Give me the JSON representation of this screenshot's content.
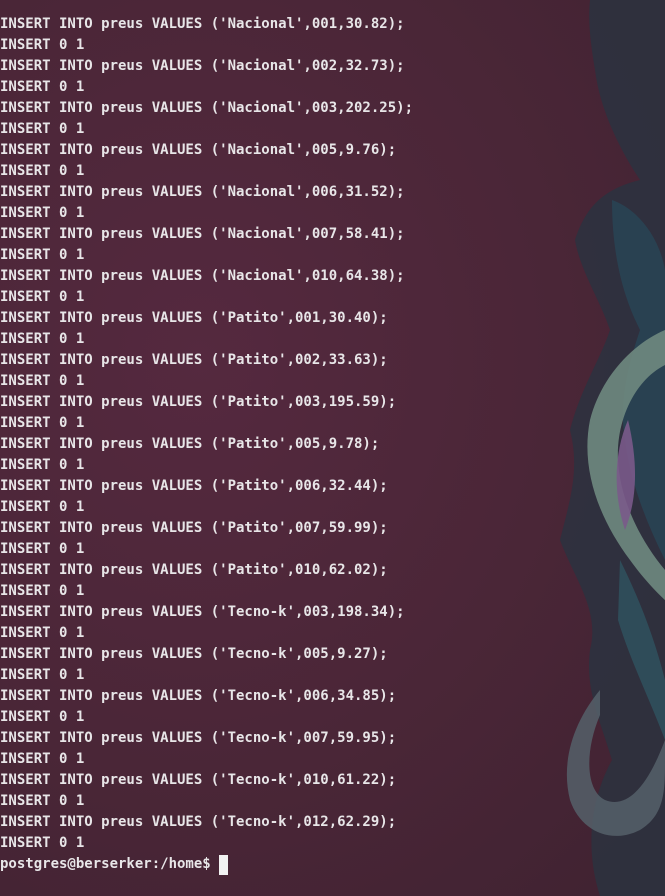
{
  "terminal": {
    "lines": [
      "INSERT INTO preus VALUES ('Nacional',001,30.82);",
      "INSERT 0 1",
      "INSERT INTO preus VALUES ('Nacional',002,32.73);",
      "INSERT 0 1",
      "INSERT INTO preus VALUES ('Nacional',003,202.25);",
      "INSERT 0 1",
      "INSERT INTO preus VALUES ('Nacional',005,9.76);",
      "INSERT 0 1",
      "INSERT INTO preus VALUES ('Nacional',006,31.52);",
      "INSERT 0 1",
      "INSERT INTO preus VALUES ('Nacional',007,58.41);",
      "INSERT 0 1",
      "INSERT INTO preus VALUES ('Nacional',010,64.38);",
      "INSERT 0 1",
      "INSERT INTO preus VALUES ('Patito',001,30.40);",
      "INSERT 0 1",
      "INSERT INTO preus VALUES ('Patito',002,33.63);",
      "INSERT 0 1",
      "INSERT INTO preus VALUES ('Patito',003,195.59);",
      "INSERT 0 1",
      "INSERT INTO preus VALUES ('Patito',005,9.78);",
      "INSERT 0 1",
      "INSERT INTO preus VALUES ('Patito',006,32.44);",
      "INSERT 0 1",
      "INSERT INTO preus VALUES ('Patito',007,59.99);",
      "INSERT 0 1",
      "INSERT INTO preus VALUES ('Patito',010,62.02);",
      "INSERT 0 1",
      "INSERT INTO preus VALUES ('Tecno-k',003,198.34);",
      "INSERT 0 1",
      "INSERT INTO preus VALUES ('Tecno-k',005,9.27);",
      "INSERT 0 1",
      "INSERT INTO preus VALUES ('Tecno-k',006,34.85);",
      "INSERT 0 1",
      "INSERT INTO preus VALUES ('Tecno-k',007,59.95);",
      "INSERT 0 1",
      "INSERT INTO preus VALUES ('Tecno-k',010,61.22);",
      "INSERT 0 1",
      "INSERT INTO preus VALUES ('Tecno-k',012,62.29);",
      "INSERT 0 1"
    ],
    "prompt": "postgres@berserker:/home$ "
  },
  "colors": {
    "background": "#4a2839",
    "text": "#e8e6e8",
    "cursor": "#f2f2f2"
  }
}
